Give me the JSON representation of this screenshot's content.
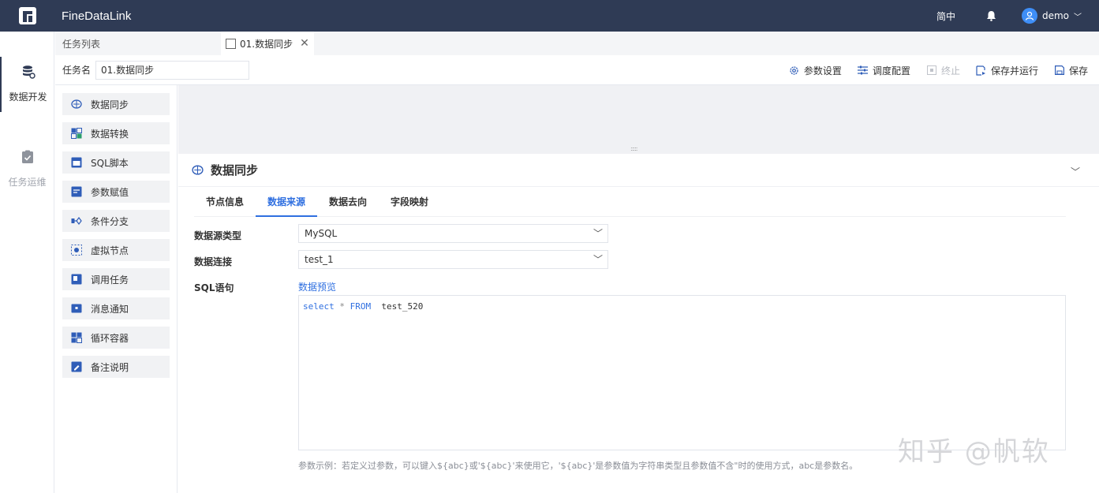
{
  "app": {
    "title": "FineDataLink",
    "language": "简中",
    "username": "demo"
  },
  "leftnav": {
    "items": [
      {
        "label": "数据开发",
        "icon": "database-icon",
        "active": true
      },
      {
        "label": "任务运维",
        "icon": "clipboard-check-icon",
        "active": false
      }
    ]
  },
  "tabs": {
    "list_label": "任务列表",
    "open_tab_label": "01.数据同步"
  },
  "task": {
    "name_label": "任务名",
    "name_value": "01.数据同步"
  },
  "toolbar": {
    "param_settings": "参数设置",
    "schedule_config": "调度配置",
    "stop": "终止",
    "save_and_run": "保存并运行",
    "save": "保存"
  },
  "palette": {
    "items": [
      {
        "label": "数据同步",
        "icon": "sync-icon"
      },
      {
        "label": "数据转换",
        "icon": "transform-icon"
      },
      {
        "label": "SQL脚本",
        "icon": "sql-script-icon"
      },
      {
        "label": "参数赋值",
        "icon": "param-assign-icon"
      },
      {
        "label": "条件分支",
        "icon": "branch-icon"
      },
      {
        "label": "虚拟节点",
        "icon": "virtual-node-icon"
      },
      {
        "label": "调用任务",
        "icon": "call-task-icon"
      },
      {
        "label": "消息通知",
        "icon": "notification-icon"
      },
      {
        "label": "循环容器",
        "icon": "loop-container-icon"
      },
      {
        "label": "备注说明",
        "icon": "note-icon"
      }
    ]
  },
  "panel": {
    "title": "数据同步",
    "tabs": [
      "节点信息",
      "数据来源",
      "数据去向",
      "字段映射"
    ],
    "active_tab": "数据来源",
    "datasource_type_label": "数据源类型",
    "datasource_type_value": "MySQL",
    "connection_label": "数据连接",
    "connection_value": "test_1",
    "sql_label": "SQL语句",
    "preview_link": "数据预览",
    "sql": {
      "kw1": "select",
      "op": "*",
      "kw2": "FROM",
      "table": "test_520"
    },
    "hint": "参数示例：若定义过参数，可以键入${abc}或'${abc}'来使用它，'${abc}'是参数值为字符串类型且参数值不含\"时的使用方式，abc是参数名。"
  },
  "watermark": "知乎 @帆软",
  "colors": {
    "topbar": "#2f3b55",
    "accent": "#2f6fe0",
    "palette_bg": "#f1f2f4"
  }
}
